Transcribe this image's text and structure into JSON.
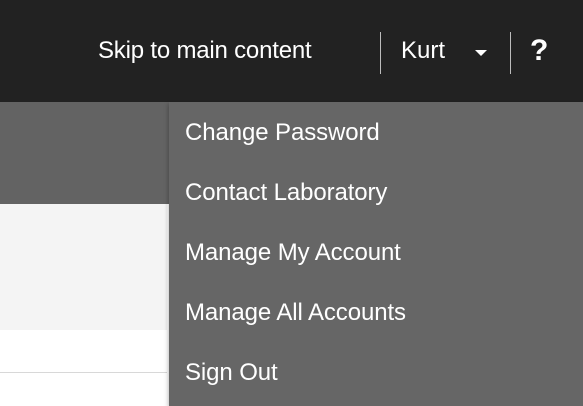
{
  "header": {
    "skip_link": "Skip to main content",
    "user_name": "Kurt",
    "help_label": "?"
  },
  "user_menu": {
    "items": [
      {
        "label": "Change Password"
      },
      {
        "label": "Contact Laboratory"
      },
      {
        "label": "Manage My Account"
      },
      {
        "label": "Manage All Accounts"
      },
      {
        "label": "Sign Out"
      }
    ]
  },
  "icons": {
    "dropdown_caret": "caret-down-icon",
    "help": "help-icon"
  },
  "colors": {
    "header_bg": "#222222",
    "subheader_bg": "#636363",
    "dropdown_bg": "#666666",
    "text": "#ffffff"
  }
}
